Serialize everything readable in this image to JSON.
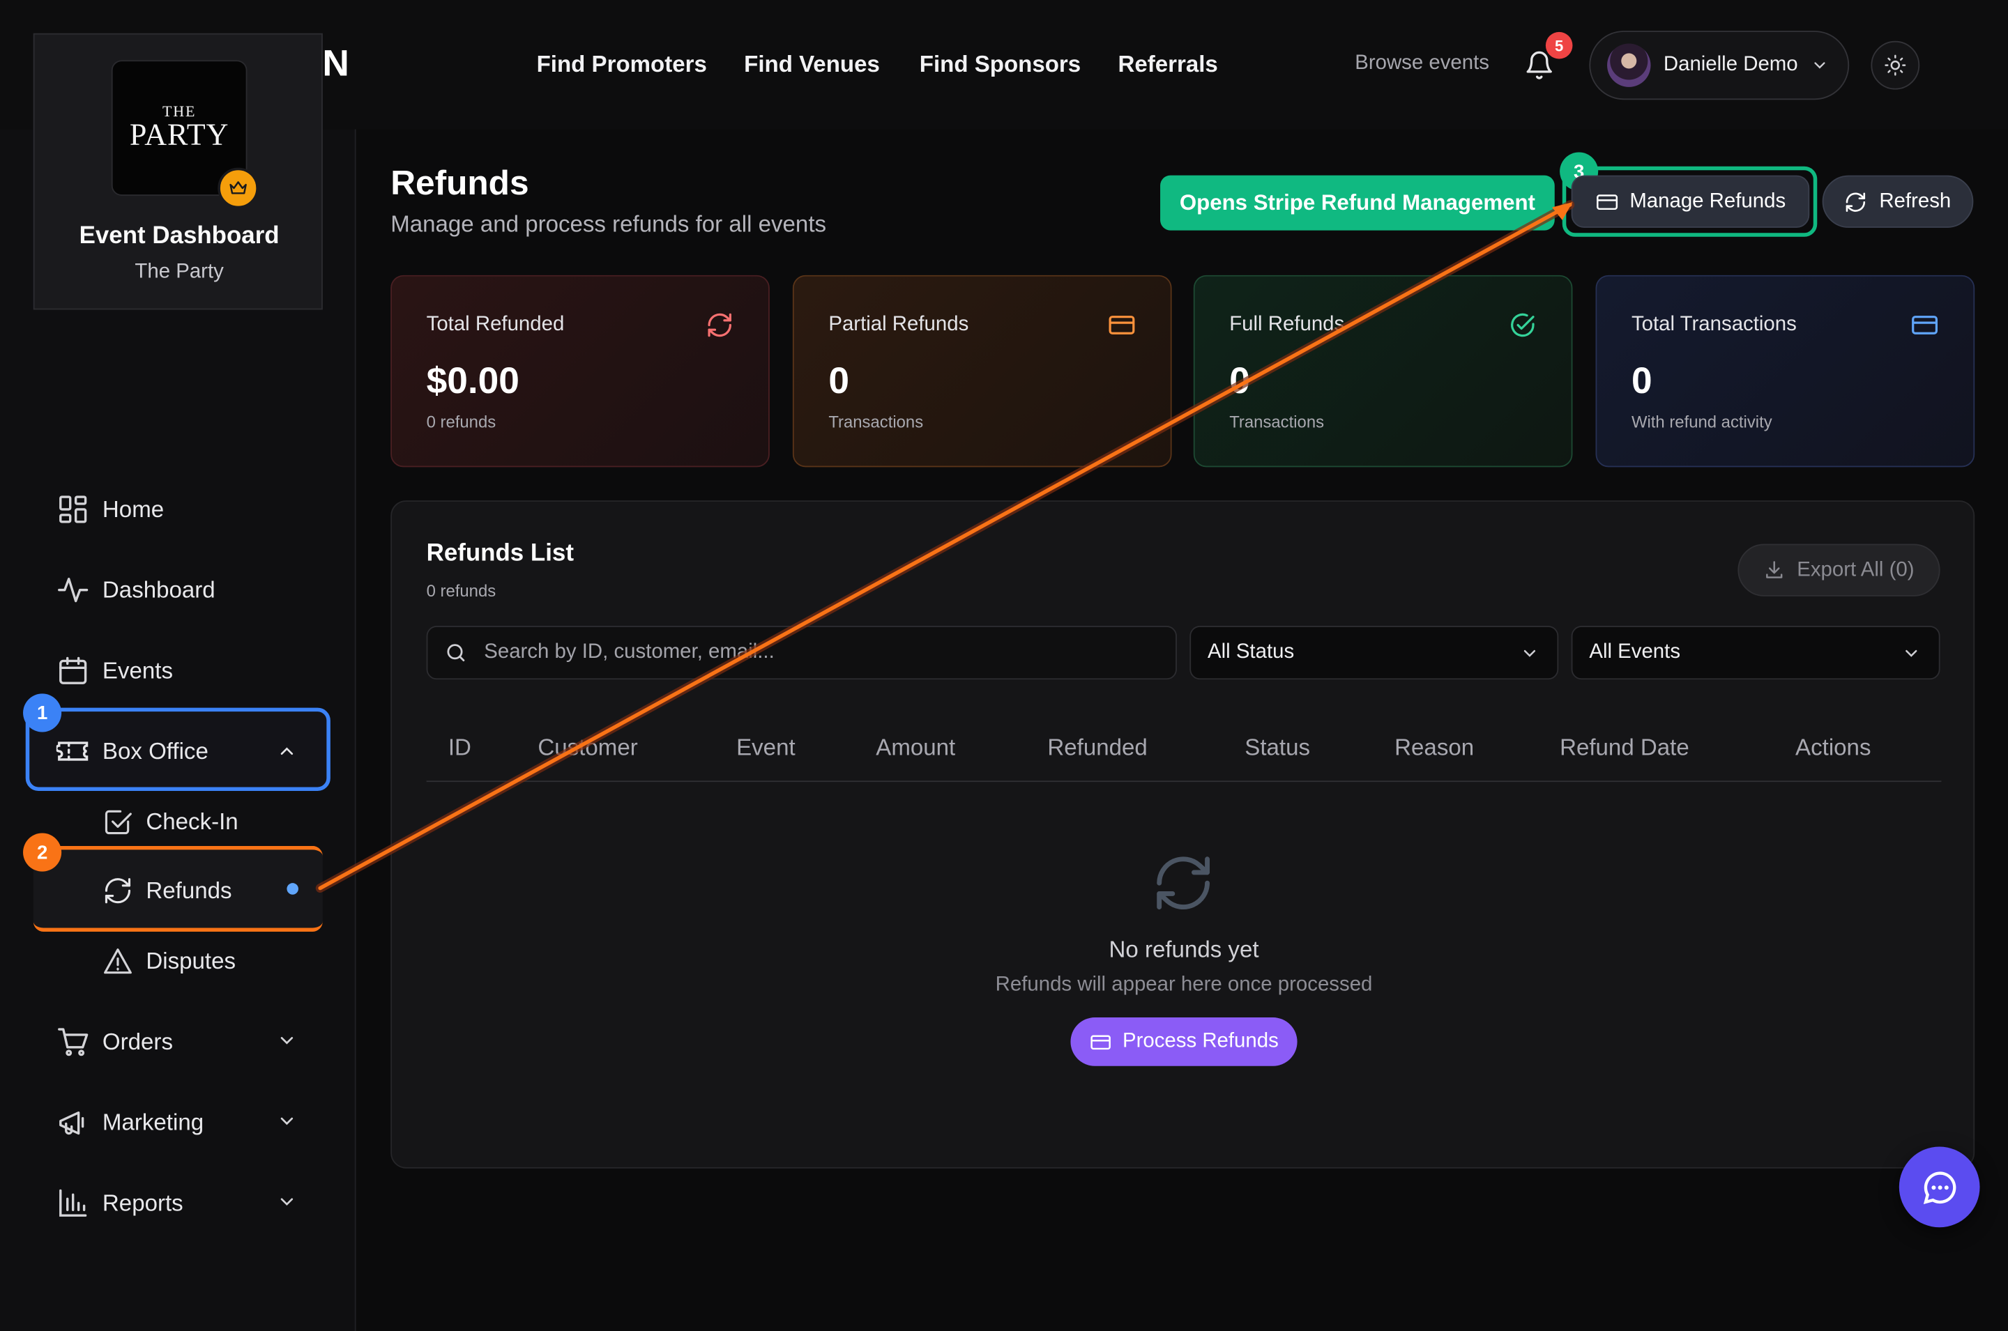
{
  "brand": {
    "name": "FUNCTN",
    "accent": "#6d5cf6"
  },
  "nav": {
    "links": [
      "Find Promoters",
      "Find Venues",
      "Find Sponsors",
      "Referrals"
    ],
    "browse": "Browse events",
    "notifications": "5",
    "user": "Danielle Demo"
  },
  "sidebar": {
    "event_logo_the": "THE",
    "event_logo_party": "PARTY",
    "event_title": "Event Dashboard",
    "event_name": "The Party",
    "items": {
      "home": "Home",
      "dashboard": "Dashboard",
      "events": "Events",
      "box_office": "Box Office",
      "check_in": "Check-In",
      "refunds": "Refunds",
      "disputes": "Disputes",
      "orders": "Orders",
      "marketing": "Marketing",
      "reports": "Reports"
    }
  },
  "steps": {
    "one": "1",
    "two": "2",
    "three": "3"
  },
  "page": {
    "title": "Refunds",
    "subtitle": "Manage and process refunds for all events",
    "callout": "Opens Stripe Refund Management",
    "manage_label": "Manage Refunds",
    "refresh_label": "Refresh"
  },
  "stats": [
    {
      "label": "Total Refunded",
      "value": "$0.00",
      "note": "0 refunds",
      "color": "#f87171",
      "icon": "refresh-icon"
    },
    {
      "label": "Partial Refunds",
      "value": "0",
      "note": "Transactions",
      "color": "#fb923c",
      "icon": "card-icon"
    },
    {
      "label": "Full Refunds",
      "value": "0",
      "note": "Transactions",
      "color": "#34d399",
      "icon": "check-circle-icon"
    },
    {
      "label": "Total Transactions",
      "value": "0",
      "note": "With refund activity",
      "color": "#60a5fa",
      "icon": "card-icon"
    }
  ],
  "list": {
    "title": "Refunds List",
    "count": "0 refunds",
    "export_label": "Export All (0)",
    "search_placeholder": "Search by ID, customer, email...",
    "status_filter": "All Status",
    "events_filter": "All Events",
    "columns": [
      "ID",
      "Customer",
      "Event",
      "Amount",
      "Refunded",
      "Status",
      "Reason",
      "Refund Date",
      "Actions"
    ],
    "empty_title": "No refunds yet",
    "empty_sub": "Refunds will appear here once processed",
    "process_label": "Process Refunds"
  }
}
